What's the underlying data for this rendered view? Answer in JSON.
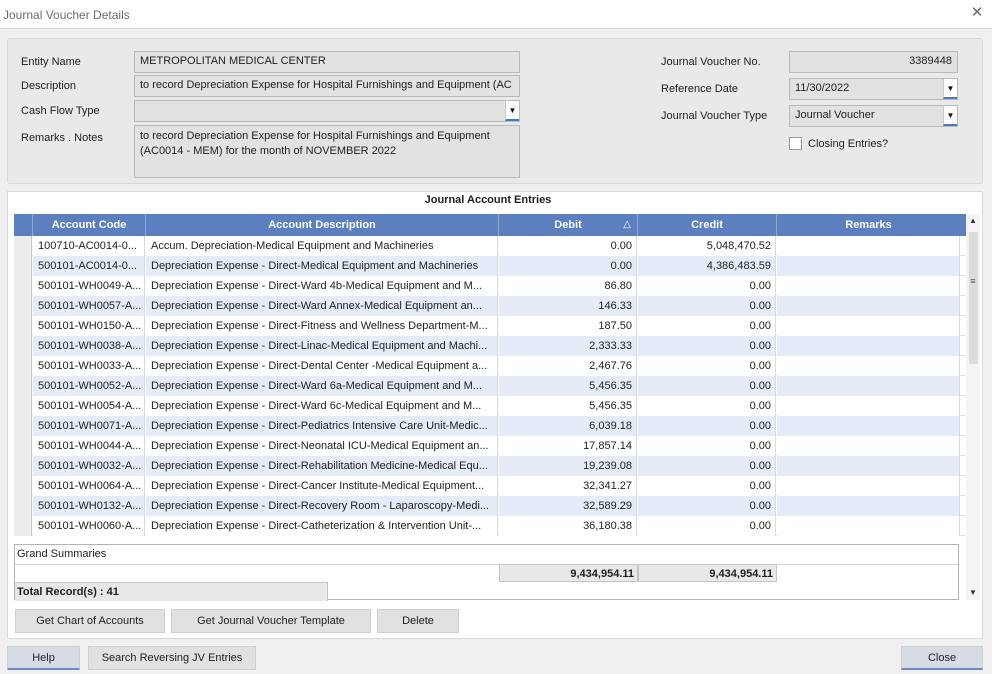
{
  "window": {
    "title": "Journal Voucher Details",
    "close_glyph": "✕"
  },
  "form": {
    "entity_name_label": "Entity Name",
    "entity_name_value": "METROPOLITAN MEDICAL CENTER",
    "description_label": "Description",
    "description_value": "to record Depreciation Expense for Hospital Furnishings and Equipment (AC",
    "cash_flow_type_label": "Cash Flow Type",
    "cash_flow_type_value": "",
    "remarks_label": "Remarks . Notes",
    "remarks_value": "to record Depreciation Expense for Hospital Furnishings and Equipment (AC0014 - MEM) for the month of NOVEMBER 2022",
    "jv_no_label": "Journal Voucher No.",
    "jv_no_value": "3389448",
    "reference_date_label": "Reference Date",
    "reference_date_value": "11/30/2022",
    "jv_type_label": "Journal Voucher Type",
    "jv_type_value": "Journal Voucher",
    "closing_entries_label": "Closing Entries?",
    "closing_entries_checked": false
  },
  "grid": {
    "caption": "Journal Account Entries",
    "columns": {
      "code": "Account Code",
      "description": "Account Description",
      "debit": "Debit",
      "credit": "Credit",
      "remarks": "Remarks"
    },
    "sort_indicator": "△",
    "rows": [
      {
        "code": "100710-AC0014-0...",
        "description": "Accum. Depreciation-Medical Equipment and Machineries",
        "debit": "0.00",
        "credit": "5,048,470.52",
        "remarks": ""
      },
      {
        "code": "500101-AC0014-0...",
        "description": "Depreciation Expense - Direct-Medical Equipment and Machineries",
        "debit": "0.00",
        "credit": "4,386,483.59",
        "remarks": ""
      },
      {
        "code": "500101-WH0049-A...",
        "description": "Depreciation Expense - Direct-Ward  4b-Medical Equipment and M...",
        "debit": "86.80",
        "credit": "0.00",
        "remarks": ""
      },
      {
        "code": "500101-WH0057-A...",
        "description": "Depreciation Expense - Direct-Ward Annex-Medical Equipment an...",
        "debit": "146.33",
        "credit": "0.00",
        "remarks": ""
      },
      {
        "code": "500101-WH0150-A...",
        "description": "Depreciation Expense - Direct-Fitness and Wellness Department-M...",
        "debit": "187.50",
        "credit": "0.00",
        "remarks": ""
      },
      {
        "code": "500101-WH0038-A...",
        "description": "Depreciation Expense - Direct-Linac-Medical Equipment and Machi...",
        "debit": "2,333.33",
        "credit": "0.00",
        "remarks": ""
      },
      {
        "code": "500101-WH0033-A...",
        "description": "Depreciation Expense - Direct-Dental Center -Medical Equipment a...",
        "debit": "2,467.76",
        "credit": "0.00",
        "remarks": ""
      },
      {
        "code": "500101-WH0052-A...",
        "description": "Depreciation Expense - Direct-Ward  6a-Medical Equipment and M...",
        "debit": "5,456.35",
        "credit": "0.00",
        "remarks": ""
      },
      {
        "code": "500101-WH0054-A...",
        "description": "Depreciation Expense - Direct-Ward  6c-Medical Equipment and M...",
        "debit": "5,456.35",
        "credit": "0.00",
        "remarks": ""
      },
      {
        "code": "500101-WH0071-A...",
        "description": "Depreciation Expense - Direct-Pediatrics Intensive Care Unit-Medic...",
        "debit": "6,039.18",
        "credit": "0.00",
        "remarks": ""
      },
      {
        "code": "500101-WH0044-A...",
        "description": "Depreciation Expense - Direct-Neonatal ICU-Medical Equipment an...",
        "debit": "17,857.14",
        "credit": "0.00",
        "remarks": ""
      },
      {
        "code": "500101-WH0032-A...",
        "description": "Depreciation Expense - Direct-Rehabilitation Medicine-Medical Equ...",
        "debit": "19,239.08",
        "credit": "0.00",
        "remarks": ""
      },
      {
        "code": "500101-WH0064-A...",
        "description": "Depreciation Expense - Direct-Cancer Institute-Medical Equipment...",
        "debit": "32,341.27",
        "credit": "0.00",
        "remarks": ""
      },
      {
        "code": "500101-WH0132-A...",
        "description": "Depreciation Expense - Direct-Recovery Room - Laparoscopy-Medi...",
        "debit": "32,589.29",
        "credit": "0.00",
        "remarks": ""
      },
      {
        "code": "500101-WH0060-A...",
        "description": "Depreciation Expense - Direct-Catheterization & Intervention Unit-...",
        "debit": "36,180.38",
        "credit": "0.00",
        "remarks": ""
      }
    ],
    "summary": {
      "caption": "Grand Summaries",
      "total_debit": "9,434,954.11",
      "total_credit": "9,434,954.11",
      "records_text": "Total Record(s) : 41"
    }
  },
  "actions": {
    "get_chart": "Get Chart of Accounts",
    "get_template": "Get Journal Voucher Template",
    "delete": "Delete"
  },
  "footer": {
    "help": "Help",
    "search_reversing": "Search Reversing JV Entries",
    "close": "Close"
  }
}
